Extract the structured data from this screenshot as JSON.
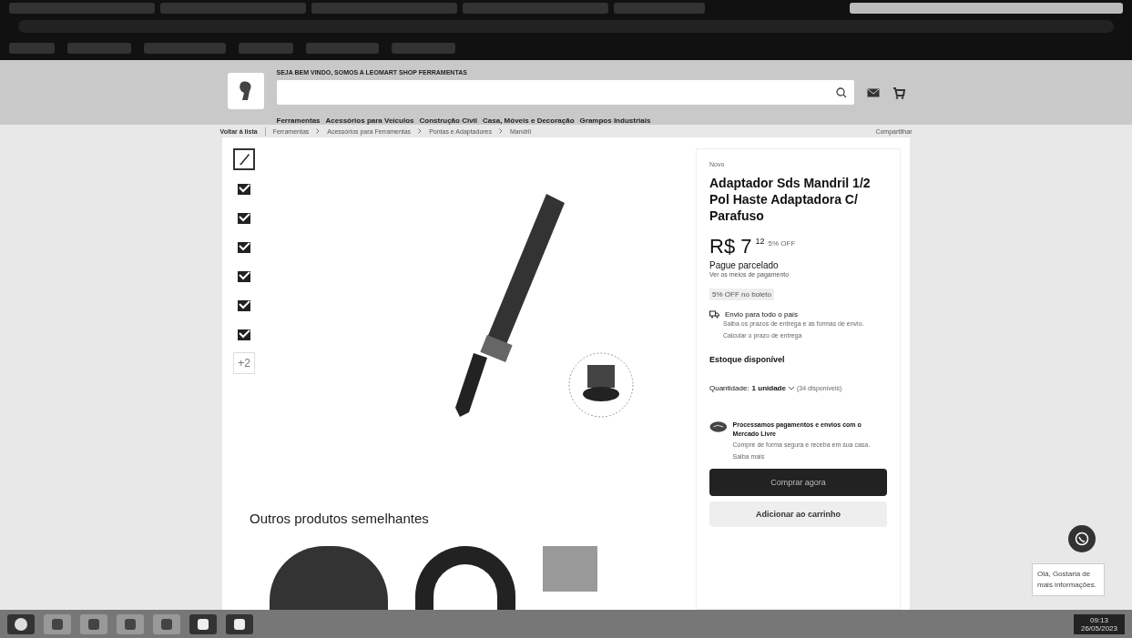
{
  "header": {
    "welcome": "SEJA BEM VINDO, SOMOS A LEOMART SHOP FERRAMENTAS",
    "categories": [
      "Ferramentas",
      "Acessórios para Veículos",
      "Construção Civil",
      "Casa, Móveis e Decoração",
      "Grampos Industriais"
    ]
  },
  "breadcrumb": {
    "back": "Voltar à lista",
    "path": [
      "Ferramentas",
      "Acessórios para Ferramentas",
      "Pontas e Adaptadores",
      "Mandril"
    ],
    "share": "Compartilhar"
  },
  "gallery": {
    "thumbnails": [
      {
        "selected": true
      },
      {
        "selected": false
      },
      {
        "selected": false
      },
      {
        "selected": false
      },
      {
        "selected": false
      },
      {
        "selected": false
      },
      {
        "selected": false
      }
    ],
    "more": "+2"
  },
  "product": {
    "condition": "Novo",
    "title": "Adaptador Sds Mandril 1/2 Pol Haste Adaptadora C/ Parafuso",
    "currency": "R$",
    "price": "7",
    "cents": "12",
    "discount": "5% OFF",
    "installments": "Pague parcelado",
    "payment_link": "Ver os meios de pagamento",
    "promo": "5% OFF no boleto",
    "shipping_title": "Envio para todo o país",
    "shipping_text": "Saiba os prazos de entrega e as formas de envio.",
    "shipping_link": "Calcular o prazo de entrega",
    "stock": "Estoque disponível",
    "quantity_label": "Quantidade:",
    "quantity_value": "1 unidade",
    "available": "(34 disponíveis)",
    "mp_title": "Processamos pagamentos e envios com o Mercado Livre",
    "mp_text": "Compre de forma segura e receba em sua casa.",
    "mp_link": "Saiba mais",
    "buy": "Comprar agora",
    "cart": "Adicionar ao carrinho"
  },
  "similar": {
    "title": "Outros produtos semelhantes"
  },
  "chat": {
    "message": "Olá, Gostaria de mais informações."
  },
  "taskbar": {
    "time": "09:13",
    "date": "26/05/2023"
  }
}
